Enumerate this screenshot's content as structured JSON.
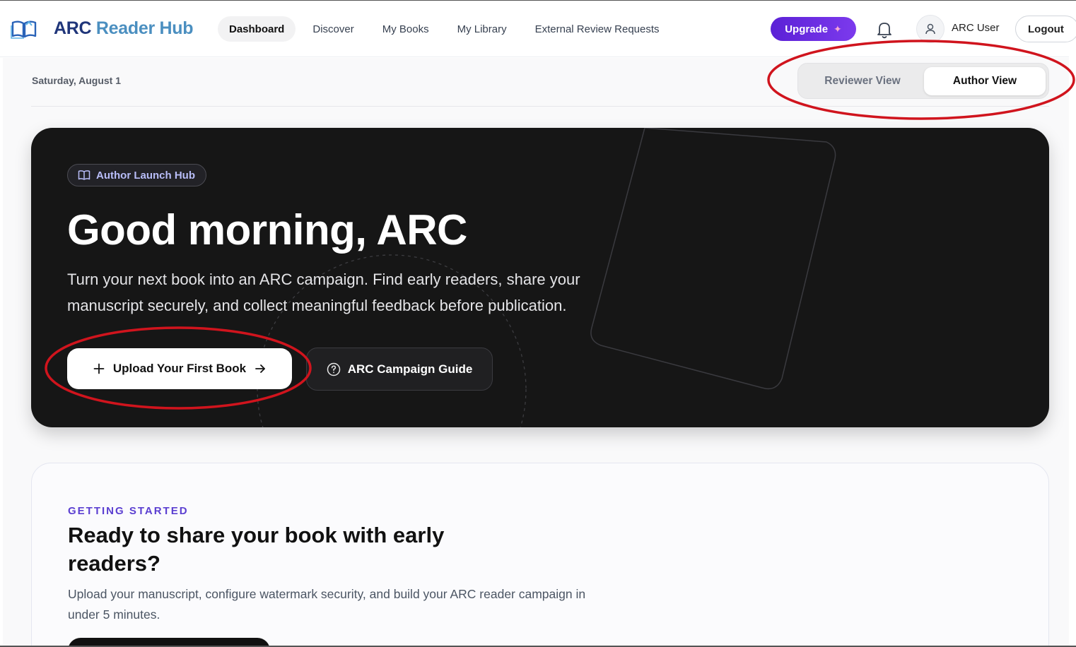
{
  "header": {
    "brand_part1": "ARC",
    "brand_part2": "Reader Hub",
    "nav": [
      {
        "label": "Dashboard",
        "active": true
      },
      {
        "label": "Discover",
        "active": false
      },
      {
        "label": "My Books",
        "active": false
      },
      {
        "label": "My Library",
        "active": false
      },
      {
        "label": "External Review Requests",
        "active": false
      }
    ],
    "upgrade_label": "Upgrade",
    "upgrade_icon": "sparkle-icon",
    "notification_icon": "bell-icon",
    "user_icon": "user-icon",
    "username": "ARC User",
    "logout_label": "Logout"
  },
  "page": {
    "date": "Saturday, August 1",
    "view_toggle": {
      "reviewer_label": "Reviewer View",
      "author_label": "Author View",
      "selected": "Author View"
    }
  },
  "hero": {
    "badge_icon": "book-open-icon",
    "badge_label": "Author Launch Hub",
    "title": "Good morning, ARC",
    "subtitle": "Turn your next book into an ARC campaign. Find early readers, share your manuscript securely, and collect meaningful feedback before publication.",
    "primary_button": "Upload Your First Book",
    "secondary_button": "ARC Campaign Guide"
  },
  "getting_started": {
    "eyebrow": "GETTING STARTED",
    "title": "Ready to share your book with early readers?",
    "subtitle": "Upload your manuscript, configure watermark security, and build your ARC reader campaign in under 5 minutes."
  },
  "colors": {
    "accent_purple": "#6d28d9",
    "brand_dark": "#20367a",
    "brand_light": "#4b8fc0",
    "hero_bg": "#161616",
    "annotation_red": "#d0141d"
  }
}
